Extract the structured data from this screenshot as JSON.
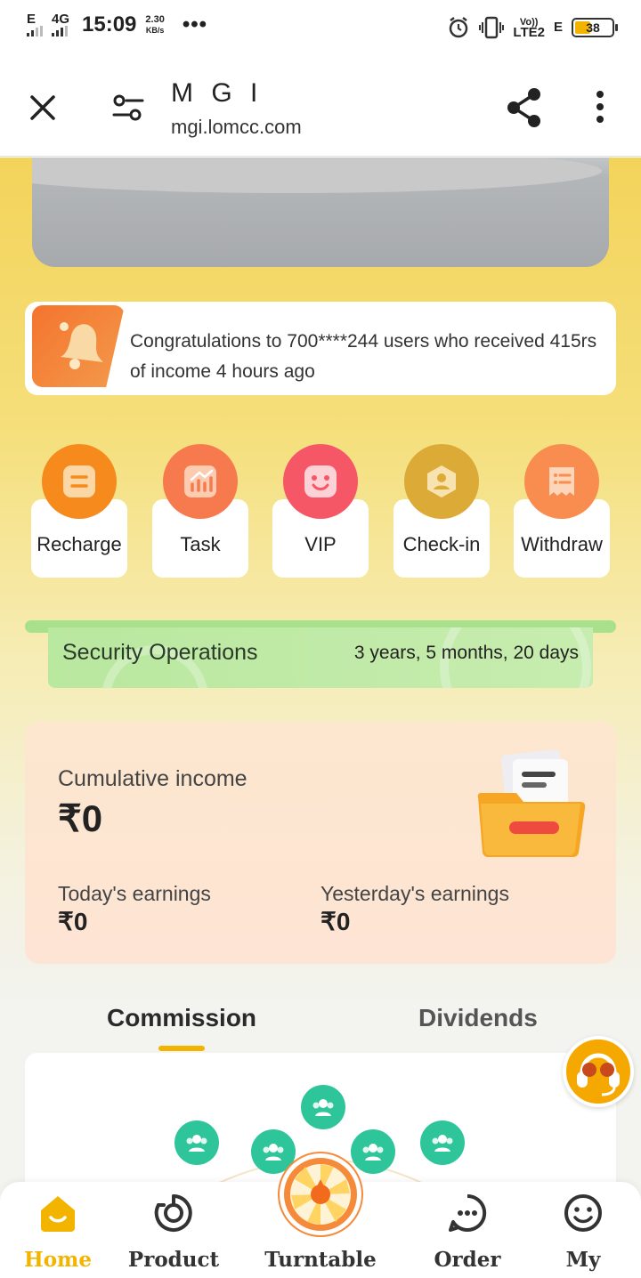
{
  "status_bar": {
    "network1": "E",
    "network2": "4G",
    "time": "15:09",
    "speed_value": "2.30",
    "speed_unit": "KB/s",
    "more": "•••",
    "volte_top": "Vo))",
    "volte_bottom": "LTE2",
    "network3": "E",
    "battery": "38"
  },
  "browser": {
    "title": "M G I",
    "url": "mgi.lomcc.com"
  },
  "notice": {
    "text": "Congratulations to 700****244 users who received 415rs of income 4 hours ago"
  },
  "quick_actions": [
    {
      "label": "Recharge",
      "icon": "recharge-icon",
      "color": "#f78a1c"
    },
    {
      "label": "Task",
      "icon": "task-icon",
      "color": "#f77a4e"
    },
    {
      "label": "VIP",
      "icon": "vip-icon",
      "color": "#f55766"
    },
    {
      "label": "Check-in",
      "icon": "check-in-icon",
      "color": "#dcaa36"
    },
    {
      "label": "Withdraw",
      "icon": "withdraw-icon",
      "color": "#f98d4f"
    }
  ],
  "security": {
    "title": "Security Operations",
    "value": "3 years, 5 months, 20 days"
  },
  "income": {
    "cumulative_label": "Cumulative income",
    "cumulative_value": "₹0",
    "today_label": "Today's earnings",
    "today_value": "₹0",
    "yesterday_label": "Yesterday's earnings",
    "yesterday_value": "₹0"
  },
  "tabs": {
    "commission": "Commission",
    "dividends": "Dividends"
  },
  "colors": {
    "accent": "#f3b400",
    "team_node": "#2ec59a"
  },
  "nav": [
    {
      "label": "Home",
      "icon": "home-icon",
      "active": true
    },
    {
      "label": "Product",
      "icon": "product-icon"
    },
    {
      "label": "Turntable",
      "icon": "turntable-icon"
    },
    {
      "label": "Order",
      "icon": "order-icon"
    },
    {
      "label": "My",
      "icon": "profile-icon"
    }
  ]
}
